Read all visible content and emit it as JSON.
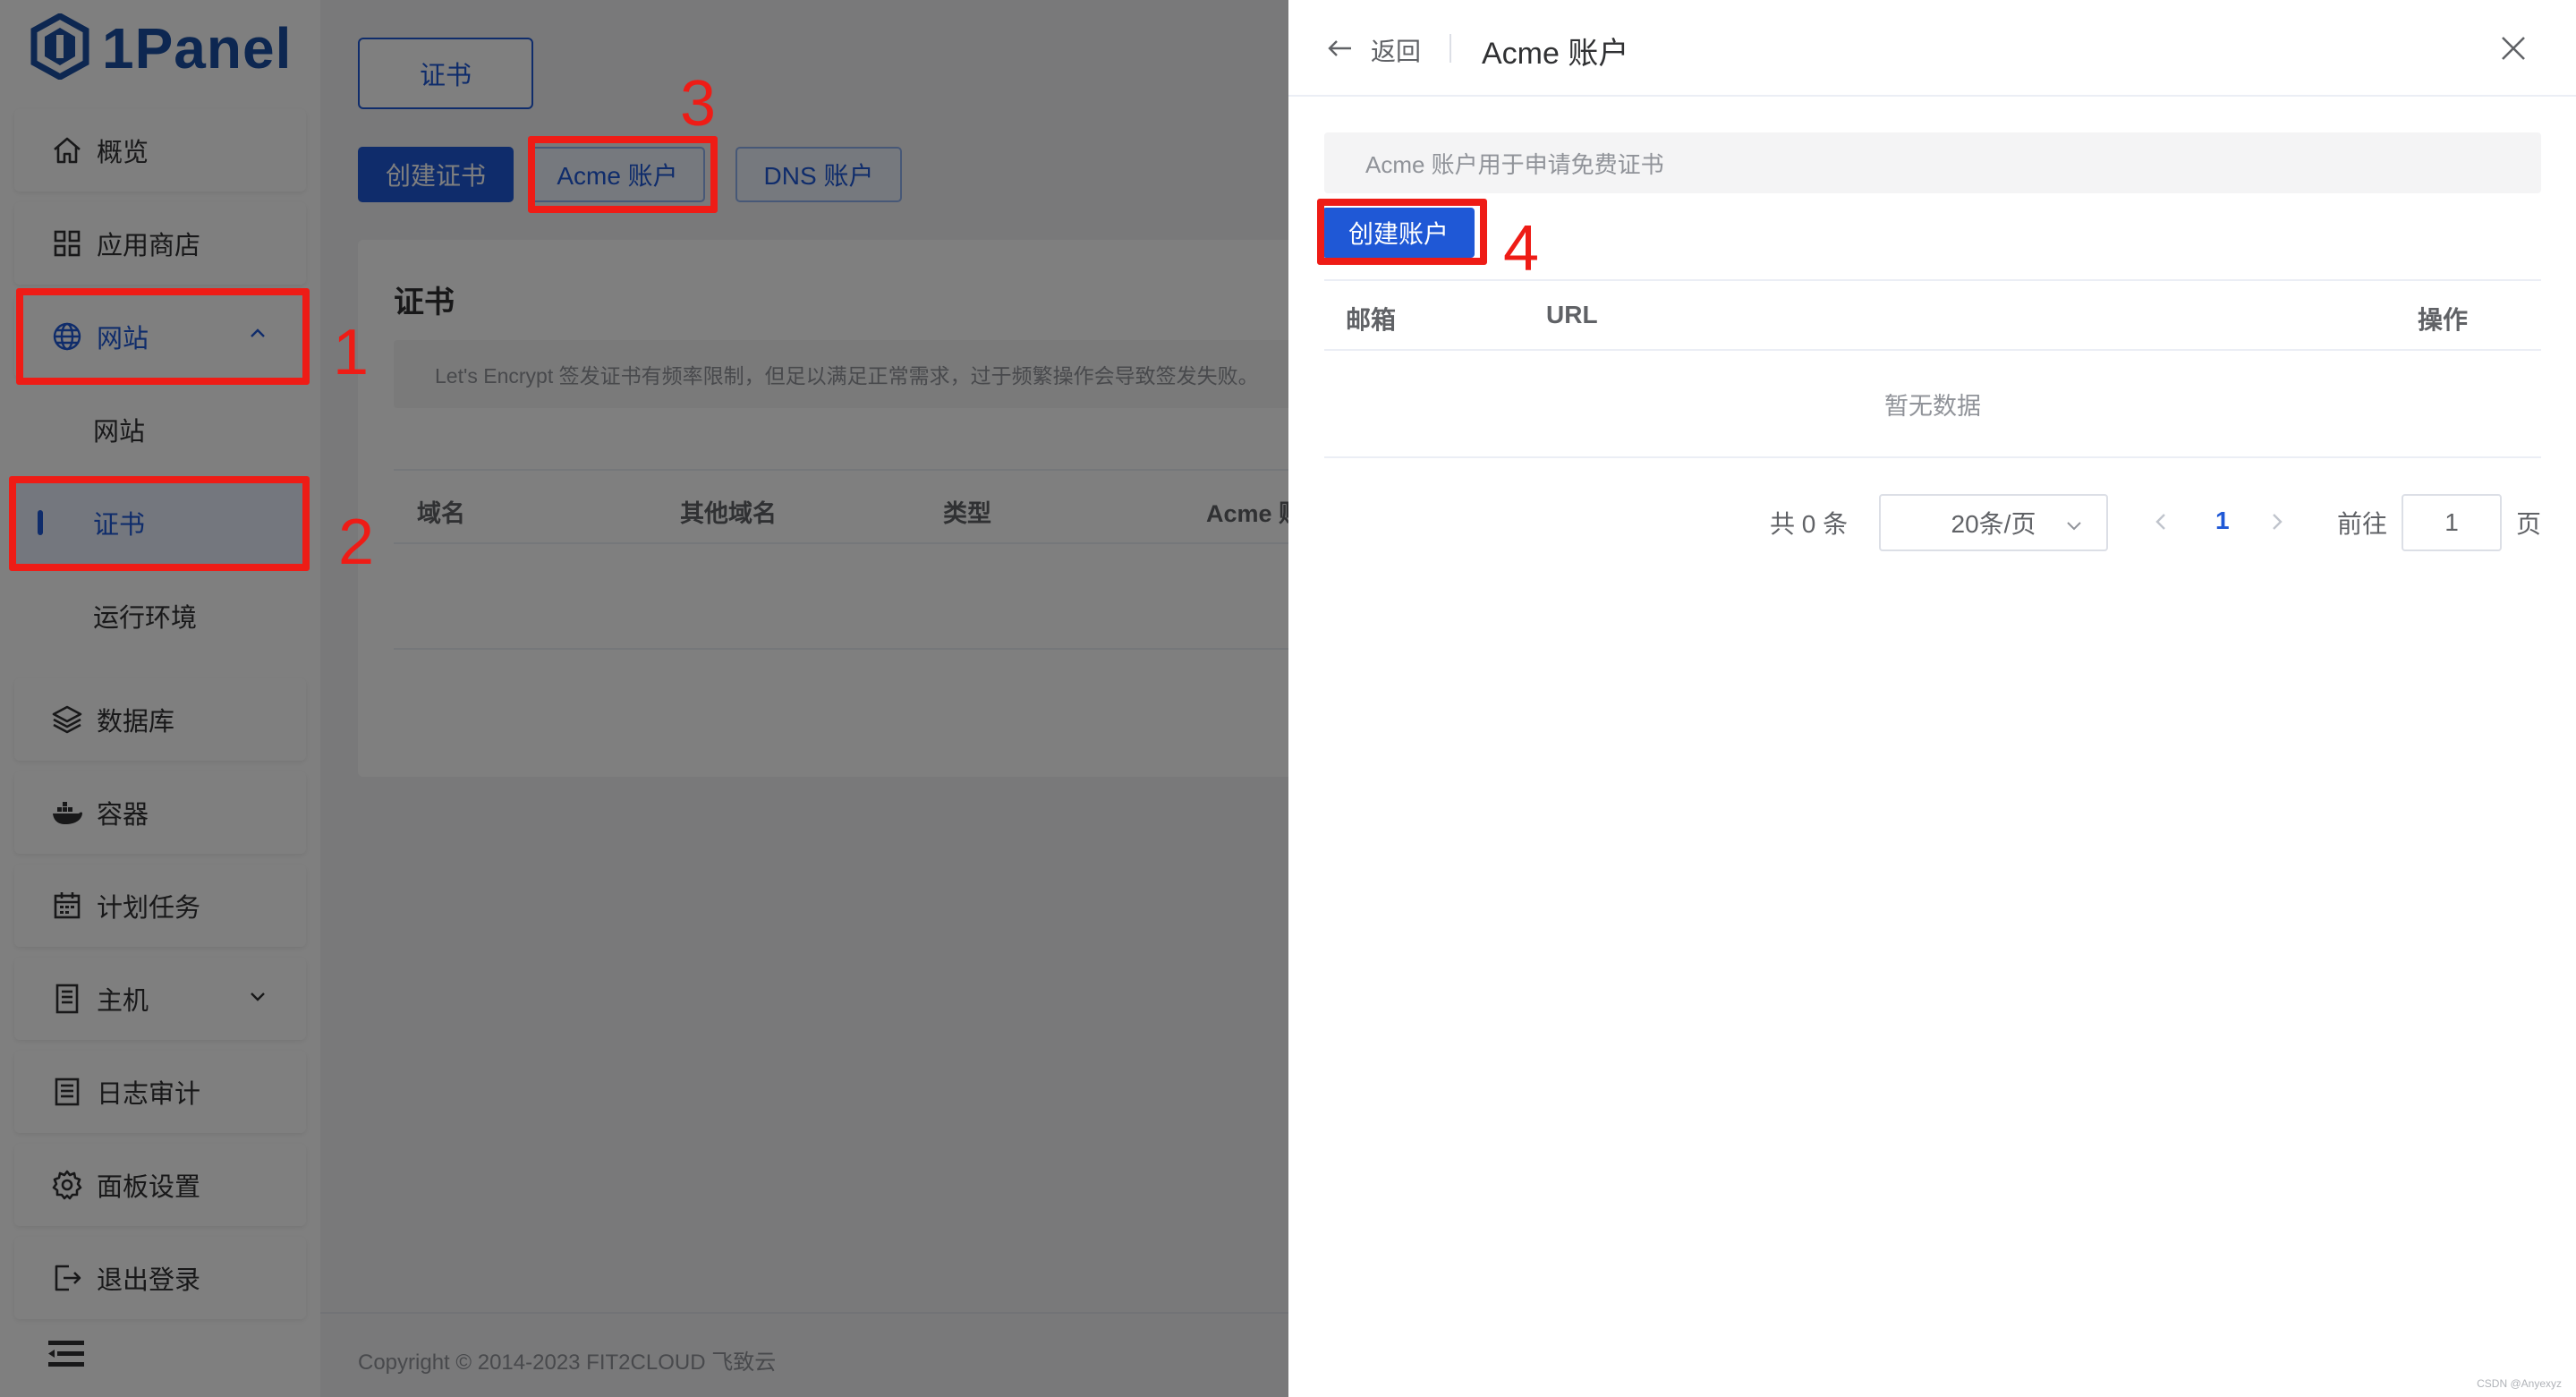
{
  "brand": {
    "logo_text": "1Panel"
  },
  "sidebar": {
    "items": [
      {
        "label": "概览"
      },
      {
        "label": "应用商店"
      },
      {
        "label": "网站"
      },
      {
        "label": "网站"
      },
      {
        "label": "证书"
      },
      {
        "label": "运行环境"
      },
      {
        "label": "数据库"
      },
      {
        "label": "容器"
      },
      {
        "label": "计划任务"
      },
      {
        "label": "主机"
      },
      {
        "label": "日志审计"
      },
      {
        "label": "面板设置"
      },
      {
        "label": "退出登录"
      }
    ]
  },
  "main": {
    "top_tab": "证书",
    "buttons": {
      "create_cert": "创建证书",
      "acme": "Acme 账户",
      "dns": "DNS 账户"
    },
    "card": {
      "title": "证书",
      "note": "Let's Encrypt 签发证书有频率限制，但足以满足正常需求，过于频繁操作会导致签发失败。",
      "columns": [
        "域名",
        "其他域名",
        "类型",
        "Acme 账户"
      ]
    },
    "footer": "Copyright © 2014-2023 FIT2CLOUD 飞致云"
  },
  "drawer": {
    "back": "返回",
    "title": "Acme 账户",
    "note": "Acme 账户用于申请免费证书",
    "create_button": "创建账户",
    "columns": {
      "email": "邮箱",
      "url": "URL",
      "actions": "操作"
    },
    "empty_text": "暂无数据",
    "pagination": {
      "total": "共 0 条",
      "page_size": "20条/页",
      "current_page": "1",
      "goto_label": "前往",
      "goto_value": "1",
      "page_suffix": "页"
    }
  },
  "annotations": [
    "1",
    "2",
    "3",
    "4"
  ],
  "watermark": "CSDN @Anyexyz",
  "colors": {
    "primary": "#1f58d6",
    "annotation_red": "#ee1c16"
  }
}
